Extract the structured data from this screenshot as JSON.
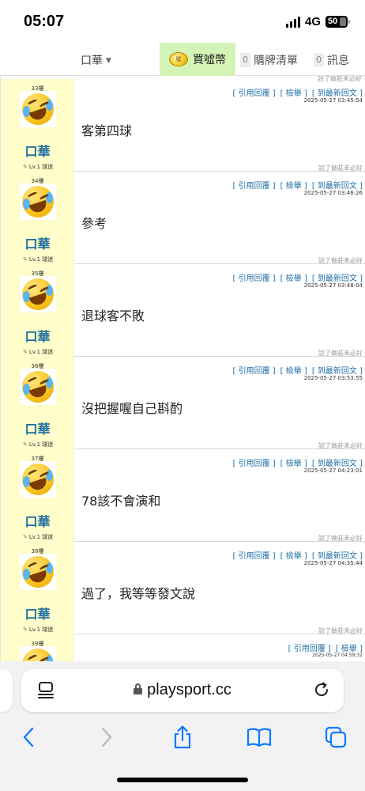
{
  "status": {
    "time": "05:07",
    "network": "4G",
    "battery": "50"
  },
  "nav": {
    "user": "口華",
    "buy": "買噓幣",
    "coin_text": "噓",
    "cart": "購牌清單",
    "cart_count": "0",
    "messages": "訊息",
    "messages_count": "0"
  },
  "top_note": "說了做莊未必好",
  "posts": [
    {
      "floor": "33樓",
      "user": "口華",
      "level": "Lv.1 球迷",
      "reply": "[ 引用回覆 ]",
      "report": "[ 檢舉 ]",
      "latest": "[ 到最新回文 ]",
      "time": "2025-05-27 03:45:54",
      "content": "客第四球",
      "note": "說了做莊未必好"
    },
    {
      "floor": "34樓",
      "user": "口華",
      "level": "Lv.1 球迷",
      "reply": "[ 引用回覆 ]",
      "report": "[ 檢舉 ]",
      "latest": "[ 到最新回文 ]",
      "time": "2025-05-27 03:46:26",
      "content": "參考",
      "note": "說了做莊未必好"
    },
    {
      "floor": "35樓",
      "user": "口華",
      "level": "Lv.1 球迷",
      "reply": "[ 引用回覆 ]",
      "report": "[ 檢舉 ]",
      "latest": "[ 到最新回文 ]",
      "time": "2025-05-27 03:48:04",
      "content": "退球客不敗",
      "note": "說了做莊未必好"
    },
    {
      "floor": "36樓",
      "user": "口華",
      "level": "Lv.1 球迷",
      "reply": "[ 引用回覆 ]",
      "report": "[ 檢舉 ]",
      "latest": "[ 到最新回文 ]",
      "time": "2025-05-27 03:53:55",
      "content": "沒把握喔自己斟酌",
      "note": "說了做莊未必好"
    },
    {
      "floor": "37樓",
      "user": "口華",
      "level": "Lv.1 球迷",
      "reply": "[ 引用回覆 ]",
      "report": "[ 檢舉 ]",
      "latest": "[ 到最新回文 ]",
      "time": "2025-05-27 04:23:01",
      "content": "78該不會演和",
      "note": "說了做莊未必好"
    },
    {
      "floor": "38樓",
      "user": "口華",
      "level": "Lv.1 球迷",
      "reply": "[ 引用回覆 ]",
      "report": "[ 檢舉 ]",
      "latest": "[ 到最新回文 ]",
      "time": "2025-05-27 04:35:44",
      "content": "過了，我等等發文說",
      "note": "說了做莊未必好"
    },
    {
      "floor": "39樓",
      "user": "",
      "level": "",
      "reply": "[ 引用回覆 ]",
      "report": "[ 檢舉 ]",
      "latest": "",
      "time": "2025-05-27 04:59:32",
      "content": "",
      "note": ""
    }
  ],
  "browser": {
    "url": "playsport.cc"
  },
  "icons": {
    "reader": "reader-mode-icon",
    "lock": "lock-icon",
    "reload": "reload-icon",
    "back": "back-icon",
    "forward": "forward-icon",
    "share": "share-icon",
    "bookmarks": "bookmarks-icon",
    "tabs": "tabs-icon"
  },
  "colors": {
    "accent": "#1c6fa8",
    "author_bg": "#fffdca",
    "buy_bg": "#d4f3b6",
    "safari_blue": "#0a7aff"
  }
}
